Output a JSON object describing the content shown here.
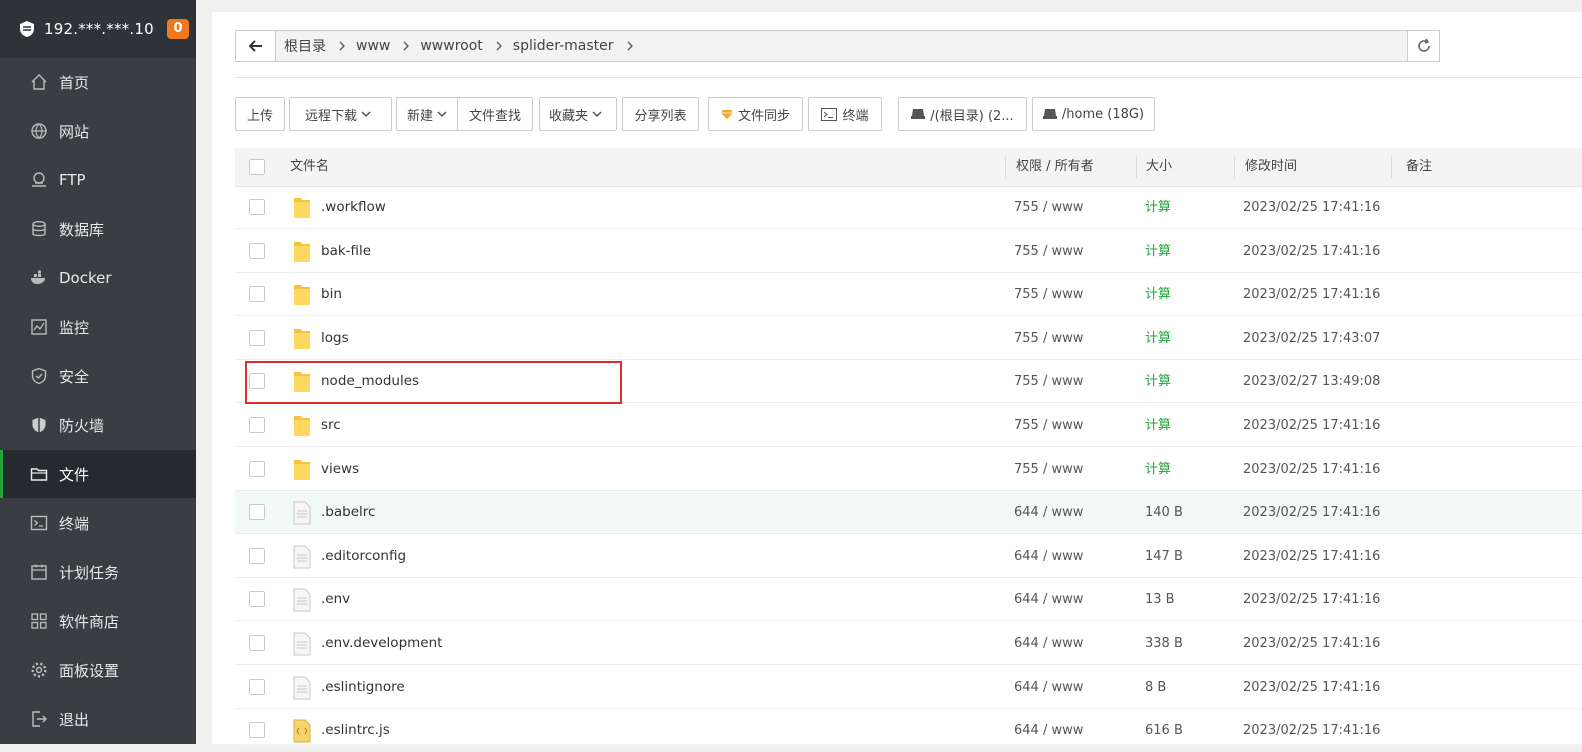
{
  "sidebar": {
    "server": "192.***.***.10",
    "badge": "0",
    "items": [
      {
        "label": "首页",
        "icon": "home-icon"
      },
      {
        "label": "网站",
        "icon": "globe-icon"
      },
      {
        "label": "FTP",
        "icon": "ftp-icon"
      },
      {
        "label": "数据库",
        "icon": "database-icon"
      },
      {
        "label": "Docker",
        "icon": "docker-icon"
      },
      {
        "label": "监控",
        "icon": "monitor-icon"
      },
      {
        "label": "安全",
        "icon": "shield-icon"
      },
      {
        "label": "防火墙",
        "icon": "firewall-icon"
      },
      {
        "label": "文件",
        "icon": "folder-icon",
        "active": true
      },
      {
        "label": "终端",
        "icon": "terminal-icon"
      },
      {
        "label": "计划任务",
        "icon": "calendar-icon"
      },
      {
        "label": "软件商店",
        "icon": "apps-icon"
      },
      {
        "label": "面板设置",
        "icon": "gear-icon"
      },
      {
        "label": "退出",
        "icon": "logout-icon"
      }
    ]
  },
  "breadcrumb": [
    "根目录",
    "www",
    "wwwroot",
    "splider-master"
  ],
  "toolbar": {
    "upload": "上传",
    "remote_download": "远程下载",
    "new": "新建",
    "file_search": "文件查找",
    "favorites": "收藏夹",
    "share_list": "分享列表",
    "file_sync": "文件同步",
    "terminal": "终端",
    "disk_root": "/(根目录) (2...",
    "disk_home": "/home (18G)"
  },
  "table": {
    "headers": {
      "name": "文件名",
      "perm": "权限 / 所有者",
      "size": "大小",
      "mtime": "修改时间",
      "note": "备注"
    },
    "rows": [
      {
        "name": ".workflow",
        "type": "folder",
        "perm": "755 / www",
        "size": "计算",
        "mtime": "2023/02/25 17:41:16"
      },
      {
        "name": "bak-file",
        "type": "folder",
        "perm": "755 / www",
        "size": "计算",
        "mtime": "2023/02/25 17:41:16"
      },
      {
        "name": "bin",
        "type": "folder",
        "perm": "755 / www",
        "size": "计算",
        "mtime": "2023/02/25 17:41:16"
      },
      {
        "name": "logs",
        "type": "folder",
        "perm": "755 / www",
        "size": "计算",
        "mtime": "2023/02/25 17:43:07"
      },
      {
        "name": "node_modules",
        "type": "folder",
        "perm": "755 / www",
        "size": "计算",
        "mtime": "2023/02/27 13:49:08"
      },
      {
        "name": "src",
        "type": "folder",
        "perm": "755 / www",
        "size": "计算",
        "mtime": "2023/02/25 17:41:16"
      },
      {
        "name": "views",
        "type": "folder",
        "perm": "755 / www",
        "size": "计算",
        "mtime": "2023/02/25 17:41:16"
      },
      {
        "name": ".babelrc",
        "type": "file",
        "perm": "644 / www",
        "size": "140 B",
        "mtime": "2023/02/25 17:41:16"
      },
      {
        "name": ".editorconfig",
        "type": "file",
        "perm": "644 / www",
        "size": "147 B",
        "mtime": "2023/02/25 17:41:16"
      },
      {
        "name": ".env",
        "type": "file",
        "perm": "644 / www",
        "size": "13 B",
        "mtime": "2023/02/25 17:41:16"
      },
      {
        "name": ".env.development",
        "type": "file",
        "perm": "644 / www",
        "size": "338 B",
        "mtime": "2023/02/25 17:41:16"
      },
      {
        "name": ".eslintignore",
        "type": "file",
        "perm": "644 / www",
        "size": "8 B",
        "mtime": "2023/02/25 17:41:16"
      },
      {
        "name": ".eslintrc.js",
        "type": "js",
        "perm": "644 / www",
        "size": "616 B",
        "mtime": "2023/02/25 17:41:16"
      }
    ]
  },
  "colors": {
    "accent": "#20a53a",
    "sidebar": "#3a3e43",
    "badge": "#f0781e",
    "highlight_box": "#e02b2b"
  }
}
